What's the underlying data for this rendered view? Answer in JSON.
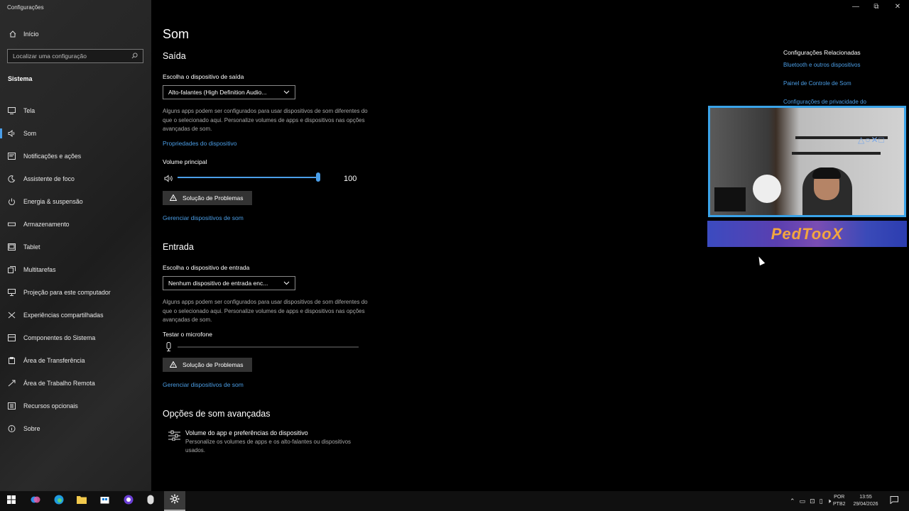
{
  "window": {
    "title": "Configurações",
    "controls": {
      "minimize": "—",
      "restore": "⧉",
      "close": "✕"
    }
  },
  "sidebar": {
    "home_label": "Início",
    "search_placeholder": "Localizar uma configuração",
    "section": "Sistema",
    "items": [
      {
        "label": "Tela",
        "icon": "display-icon"
      },
      {
        "label": "Som",
        "icon": "speaker-icon",
        "active": true
      },
      {
        "label": "Notificações e ações",
        "icon": "notification-icon"
      },
      {
        "label": "Assistente de foco",
        "icon": "moon-icon"
      },
      {
        "label": "Energia & suspensão",
        "icon": "power-icon"
      },
      {
        "label": "Armazenamento",
        "icon": "storage-icon"
      },
      {
        "label": "Tablet",
        "icon": "tablet-icon"
      },
      {
        "label": "Multitarefas",
        "icon": "multitask-icon"
      },
      {
        "label": "Projeção para este computador",
        "icon": "projection-icon"
      },
      {
        "label": "Experiências compartilhadas",
        "icon": "share-icon"
      },
      {
        "label": "Componentes do Sistema",
        "icon": "components-icon"
      },
      {
        "label": "Área de Transferência",
        "icon": "clipboard-icon"
      },
      {
        "label": "Área de Trabalho Remota",
        "icon": "remote-icon"
      },
      {
        "label": "Recursos opcionais",
        "icon": "features-icon"
      },
      {
        "label": "Sobre",
        "icon": "info-icon"
      }
    ]
  },
  "main": {
    "title": "Som",
    "output": {
      "heading": "Saída",
      "choose_label": "Escolha o dispositivo de saída",
      "device": "Alto-falantes (High Definition Audio...",
      "desc": "Alguns apps podem ser configurados para usar dispositivos de som diferentes do que o selecionado aqui. Personalize volumes de apps e dispositivos nas opções avançadas de som.",
      "properties_link": "Propriedades do dispositivo",
      "volume_label": "Volume principal",
      "volume_value": "100",
      "volume_fraction": 1.0,
      "troubleshoot": "Solução de Problemas",
      "manage_link": "Gerenciar dispositivos de som"
    },
    "input": {
      "heading": "Entrada",
      "choose_label": "Escolha o dispositivo de entrada",
      "device": "Nenhum dispositivo de entrada enc...",
      "desc": "Alguns apps podem ser configurados para usar dispositivos de som diferentes do que o selecionado aqui. Personalize volumes de apps e dispositivos nas opções avançadas de som.",
      "test_label": "Testar o microfone",
      "troubleshoot": "Solução de Problemas",
      "manage_link": "Gerenciar dispositivos de som"
    },
    "advanced": {
      "heading": "Opções de som avançadas",
      "item_title": "Volume do app e preferências do dispositivo",
      "item_desc": "Personalize os volumes de apps e os alto-falantes ou dispositivos usados."
    }
  },
  "related": {
    "title": "Configurações Relacionadas",
    "links": [
      "Bluetooth e outros dispositivos",
      "Painel de Controle de Som",
      "Configurações de privacidade do"
    ]
  },
  "overlay": {
    "banner_text": "PedTooX"
  },
  "taskbar": {
    "lang": "POR",
    "layout": "PTB2",
    "time": "13:55",
    "date": "29/04/2026"
  },
  "colors": {
    "accent": "#4a9ee8",
    "link": "#4b9ee6",
    "background": "#000000",
    "sidebar": "#262626"
  }
}
